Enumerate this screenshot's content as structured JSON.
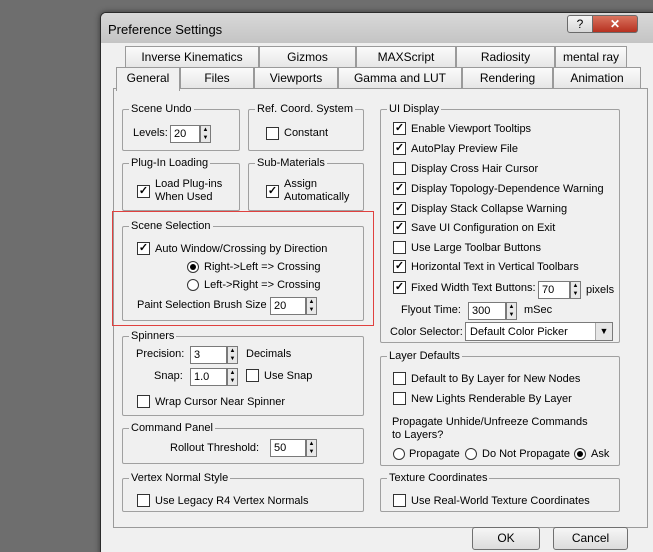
{
  "window": {
    "title": "Preference Settings",
    "help": "?",
    "close": "✕"
  },
  "tabs_row1": [
    "Inverse Kinematics",
    "Gizmos",
    "MAXScript",
    "Radiosity",
    "mental ray"
  ],
  "tabs_row2": [
    "General",
    "Files",
    "Viewports",
    "Gamma and LUT",
    "Rendering",
    "Animation"
  ],
  "active_tab": "General",
  "scene_undo": {
    "title": "Scene Undo",
    "levels_label": "Levels:",
    "levels_value": "20"
  },
  "ref_coord": {
    "title": "Ref. Coord. System",
    "constant": "Constant"
  },
  "plugin_loading": {
    "title": "Plug-In Loading",
    "load_line1": "Load Plug-ins",
    "load_line2": "When Used"
  },
  "sub_materials": {
    "title": "Sub-Materials",
    "assign_line1": "Assign",
    "assign_line2": "Automatically"
  },
  "scene_selection": {
    "title": "Scene Selection",
    "auto_window": "Auto Window/Crossing by Direction",
    "rl_crossing": "Right->Left => Crossing",
    "lr_crossing": "Left->Right => Crossing",
    "brush_size_label": "Paint Selection Brush Size",
    "brush_size_value": "20"
  },
  "spinners": {
    "title": "Spinners",
    "precision_label": "Precision:",
    "precision_value": "3",
    "decimals": "Decimals",
    "snap_label": "Snap:",
    "snap_value": "1.0",
    "use_snap": "Use Snap",
    "wrap_cursor": "Wrap Cursor Near Spinner"
  },
  "command_panel": {
    "title": "Command Panel",
    "rollout_label": "Rollout Threshold:",
    "rollout_value": "50"
  },
  "vertex_normal": {
    "title": "Vertex Normal Style",
    "legacy": "Use Legacy R4 Vertex Normals"
  },
  "ui_display": {
    "title": "UI Display",
    "items": [
      "Enable Viewport Tooltips",
      "AutoPlay Preview File",
      "Display Cross Hair Cursor",
      "Display Topology-Dependence Warning",
      "Display Stack Collapse Warning",
      "Save UI Configuration on Exit",
      "Use Large Toolbar Buttons",
      "Horizontal Text in Vertical Toolbars"
    ],
    "fixed_width": "Fixed Width Text Buttons:",
    "fixed_width_value": "70",
    "pixels": "pixels",
    "flyout_label": "Flyout Time:",
    "flyout_value": "300",
    "msec": "mSec",
    "color_selector_label": "Color Selector:",
    "color_selector_value": "Default Color Picker"
  },
  "layer_defaults": {
    "title": "Layer Defaults",
    "default_by_layer": "Default to By Layer for New Nodes",
    "new_lights": "New Lights Renderable By Layer",
    "propagate_q1": "Propagate Unhide/Unfreeze Commands",
    "propagate_q2": "to Layers?",
    "propagate": "Propagate",
    "do_not_propagate": "Do Not Propagate",
    "ask": "Ask"
  },
  "texture_coords": {
    "title": "Texture Coordinates",
    "real_world": "Use Real-World Texture Coordinates"
  },
  "buttons": {
    "ok": "OK",
    "cancel": "Cancel"
  },
  "colors": {
    "highlight_box": "#e0413f",
    "close_button": "#c0402c"
  }
}
